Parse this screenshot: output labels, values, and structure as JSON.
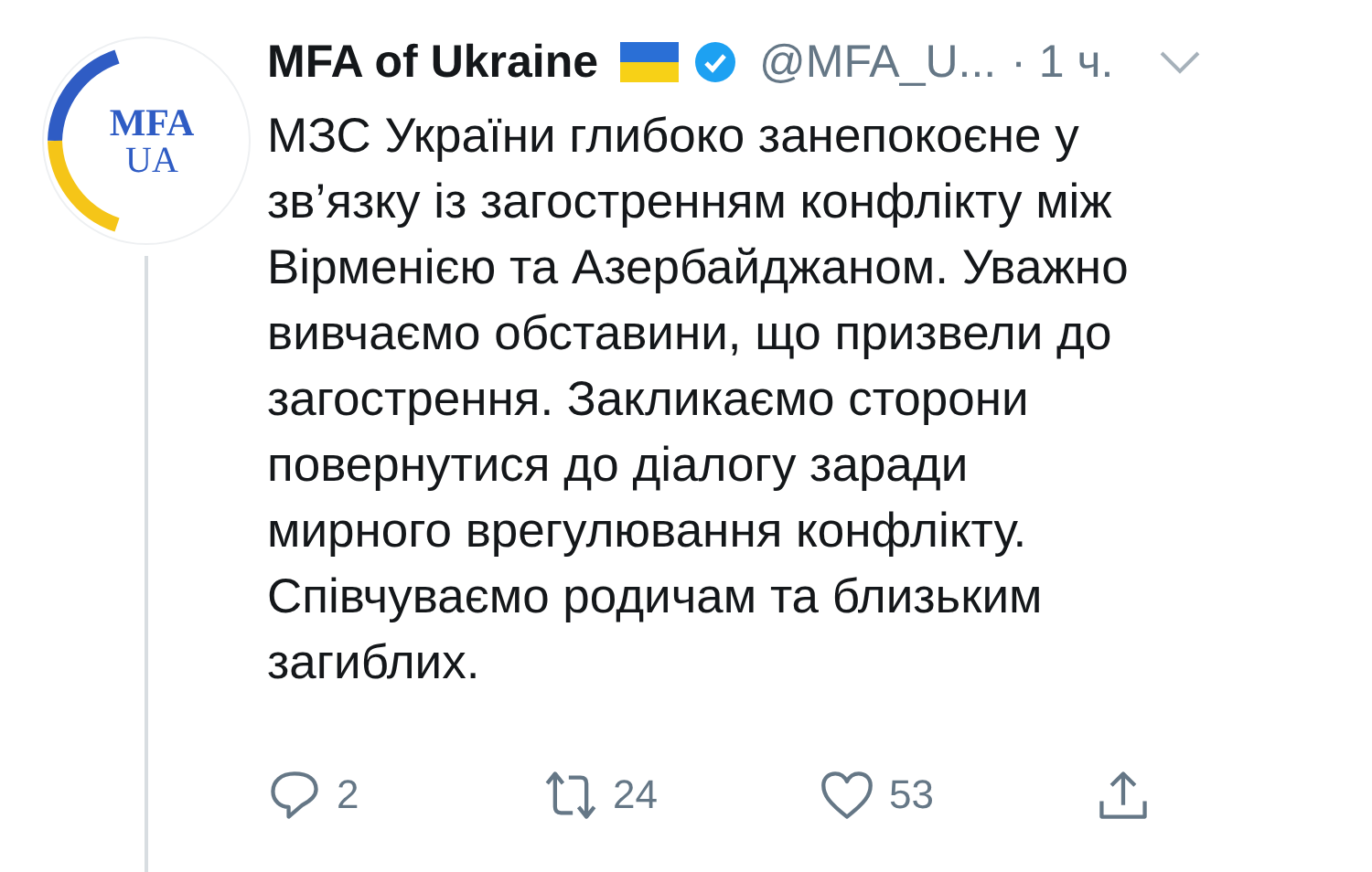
{
  "tweet": {
    "author": {
      "name": "MFA of Ukraine",
      "verified": true,
      "handle": "@MFA_U...",
      "time": "· 1 ч.",
      "avatar": {
        "line1": "MFA",
        "line2": "UA"
      }
    },
    "text": "МЗС України глибоко занепокоєне у\nзв’язку із загостренням конфлікту між\nВірменією та Азербайджаном. Уважно\nвивчаємо обставини, що призвели до\nзагострення. Закликаємо сторони\nповернутися до діалогу заради\nмирного врегулювання конфлікту.\nСпівчуваємо родичам та близьким\nзагиблих.",
    "actions": [
      {
        "kind": "reply",
        "count": "2"
      },
      {
        "kind": "retweet",
        "count": "24"
      },
      {
        "kind": "like",
        "count": "53"
      },
      {
        "kind": "share"
      }
    ]
  }
}
